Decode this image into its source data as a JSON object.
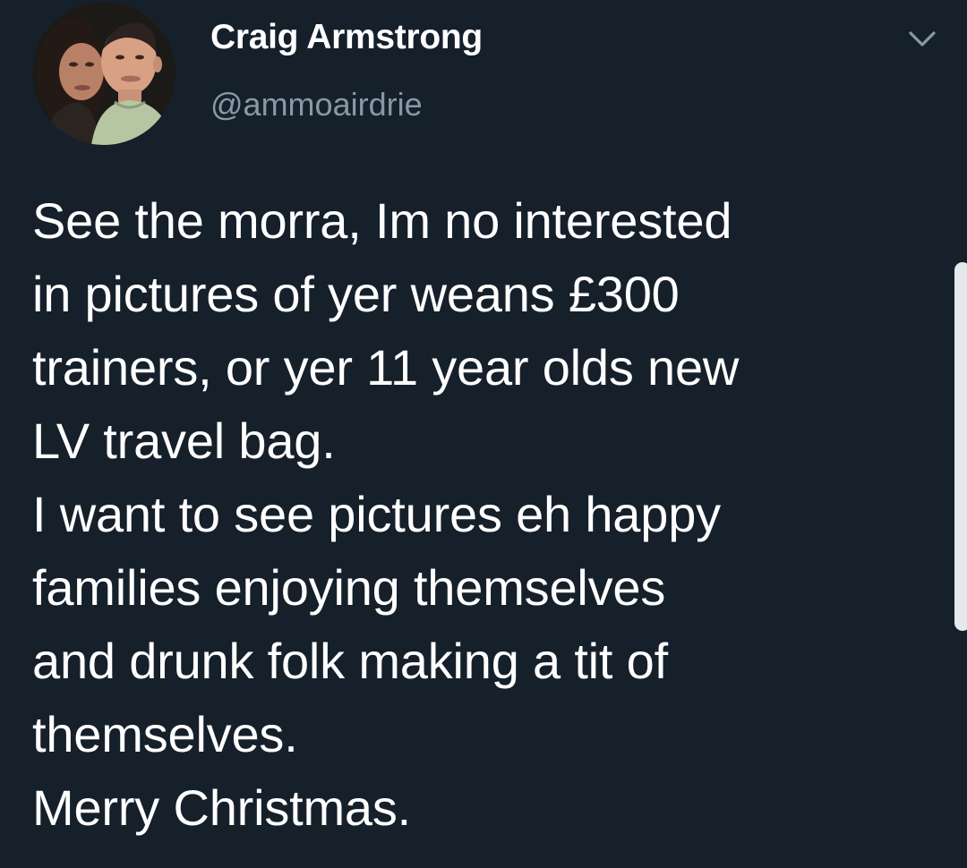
{
  "tweet": {
    "display_name": "Craig Armstrong",
    "handle": "@ammoairdrie",
    "text": "See the morra, Im no interested\nin pictures of yer weans £300\ntrainers, or yer 11 year olds new\nLV travel bag.\nI want to see pictures eh happy\nfamilies enjoying themselves\nand drunk folk making a tit of\nthemselves.\nMerry Christmas."
  },
  "icons": {
    "menu": "chevron-down-icon"
  },
  "colors": {
    "background": "#15202b",
    "primary_text": "#ffffff",
    "secondary_text": "#8899a6"
  }
}
